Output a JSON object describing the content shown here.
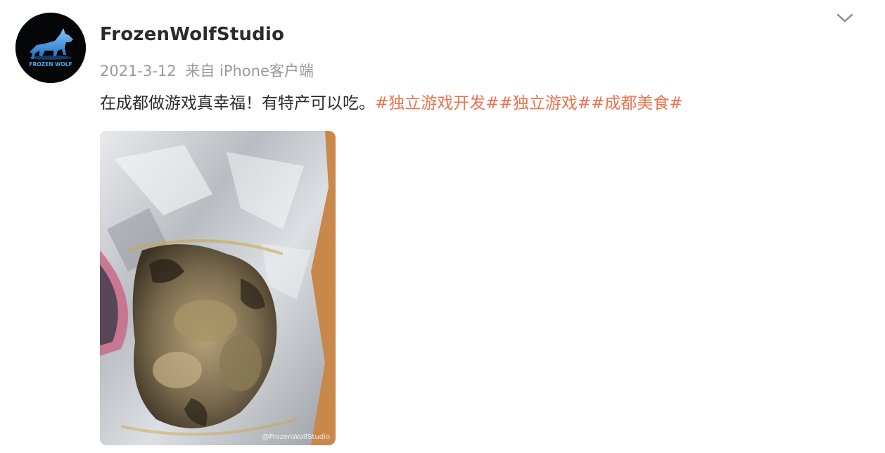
{
  "post": {
    "username": "FrozenWolfStudio",
    "avatar_text": "FROZEN WOLF",
    "date": "2021-3-12",
    "source": "来自 iPhone客户端",
    "text": "在成都做游戏真幸福！有特产可以吃。",
    "hashtags": [
      "#独立游戏开发#",
      "#独立游戏#",
      "#成都美食#"
    ],
    "more_icon": "chevron-down-icon",
    "image": {
      "description_icon": "food-photo",
      "watermark": "@FrozenWolfStudio"
    }
  },
  "colors": {
    "hashtag": "#eb7350",
    "meta": "#9a9a9a",
    "username": "#2b2b2b",
    "avatar_bg": "#050608",
    "wolf": "#3aa0f0"
  }
}
